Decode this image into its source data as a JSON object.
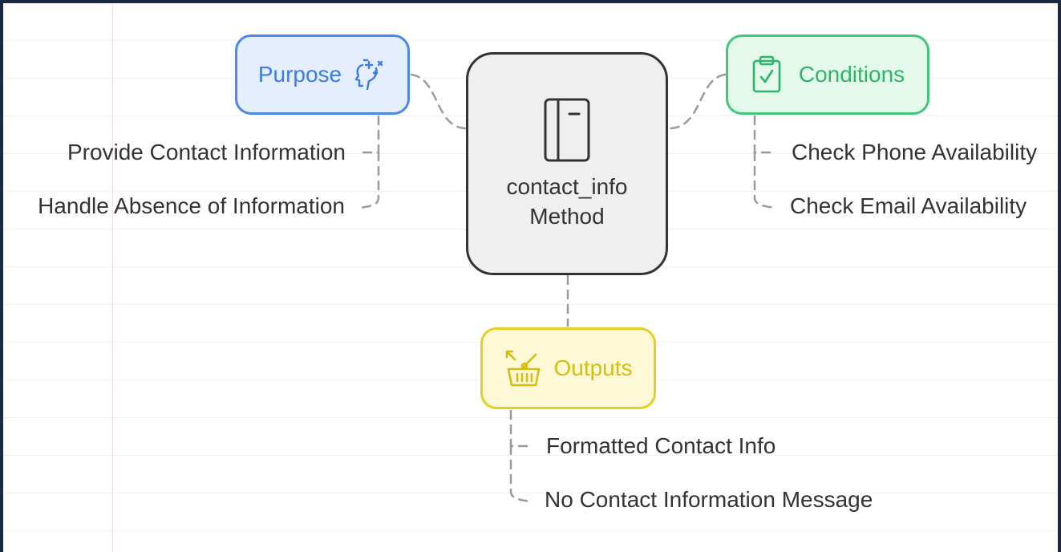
{
  "nodes": {
    "center": {
      "line1": "contact_info",
      "line2": "Method",
      "icon": "notebook-icon"
    },
    "purpose": {
      "label": "Purpose",
      "icon": "head-sparkle-icon",
      "color": "#4a89e8"
    },
    "conditions": {
      "label": "Conditions",
      "icon": "clipboard-check-icon",
      "color": "#40c97a"
    },
    "outputs": {
      "label": "Outputs",
      "icon": "basket-icon",
      "color": "#e5cf23"
    }
  },
  "leaves": {
    "purpose": [
      "Provide Contact Information",
      "Handle Absence of Information"
    ],
    "conditions": [
      "Check Phone Availability",
      "Check Email Availability"
    ],
    "outputs": [
      "Formatted Contact Info",
      "No Contact Information Message"
    ]
  }
}
